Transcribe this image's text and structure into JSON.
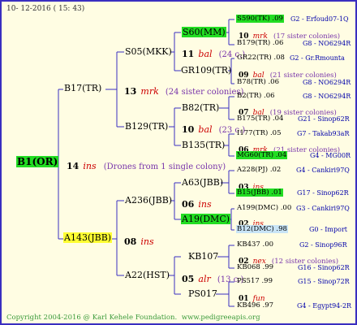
{
  "header": {
    "date": "10- 12-2016 ( 15: 43)"
  },
  "footer": {
    "copyright": "Copyright 2004-2016 @ Karl Kehele Foundation.",
    "site": "www.pedigreeapis.org"
  },
  "colors": {
    "frame_bg": "#fffde3",
    "border": "#3a2ec0",
    "line": "#3a2ec0",
    "highlight_green": "#22dd22",
    "highlight_yellow": "#ffff33",
    "highlight_blue": "#c8e4f6",
    "location": "#0000aa",
    "breeder": "#cc0000",
    "sister": "#7733aa"
  },
  "root": {
    "name": "B1(OR)",
    "gen": "14",
    "breeder": "ins",
    "note": "(Drones from 1 single colony)"
  },
  "father": {
    "name": "B17(TR)",
    "gen": "13",
    "breeder": "mrk",
    "note": "(24 sister colonies)",
    "f": {
      "name": "S05(MKK)",
      "gen": "11",
      "breeder": "bal",
      "note": "(24 c.)",
      "f": {
        "name": "S60(MM)",
        "top": "S590(TK) .09",
        "top_loc": "G2 - Erfoud07-1Q",
        "gen": "10",
        "breeder": "mrk",
        "note": "(17 sister colonies)",
        "bottom": "B179(TR) .06",
        "bottom_loc": "G8 - NO6294R"
      },
      "m": {
        "name": "GR109(TR)",
        "top": "GR22(TR) .08",
        "top_loc": "G2 - Gr.Rmounta",
        "gen": "09",
        "breeder": "bal",
        "note": "(21 sister colonies)",
        "bottom": "B78(TR) .06",
        "bottom_loc": "G8 - NO6294R"
      }
    },
    "m": {
      "name": "B129(TR)",
      "gen": "10",
      "breeder": "bal",
      "note": "(23 c.)",
      "f": {
        "name": "B82(TR)",
        "top": "B2(TR) .06",
        "top_loc": "G8 - NO6294R",
        "gen": "07",
        "breeder": "bal",
        "note": "(19 sister colonies)",
        "bottom": "B175(TR) .04",
        "bottom_loc": "G21 - Sinop62R"
      },
      "m": {
        "name": "B135(TR)",
        "top": "I177(TR) .05",
        "top_loc": "G7 - Takab93aR",
        "gen": "06",
        "breeder": "mrk",
        "note": "(21 sister colonies)",
        "bottom": "MG60(TR) .04",
        "bottom_loc": "G4 - MG00R"
      }
    }
  },
  "mother": {
    "name": "A143(JBB)",
    "gen": "08",
    "breeder": "ins",
    "f": {
      "name": "A236(JBB)",
      "gen": "06",
      "breeder": "ins",
      "f": {
        "name": "A63(JBB)",
        "top": "A228(PJ) .02",
        "top_loc": "G4 - Cankiri97Q",
        "gen": "03",
        "breeder": "ins",
        "bottom": "B15(JBB) .01",
        "bottom_loc": "G17 - Sinop62R"
      },
      "m": {
        "name": "A19(DMC)",
        "top": "A199(DMC) .00",
        "top_loc": "G3 - Cankiri97Q",
        "gen": "02",
        "breeder": "ins",
        "bottom": "B12(DMC) .98",
        "bottom_loc": "G0 - Import"
      }
    },
    "m": {
      "name": "A22(HST)",
      "gen": "05",
      "breeder": "alr",
      "note": "(13 c.)",
      "f": {
        "name": "KB107",
        "top": "KB437 .00",
        "top_loc": "G2 - Sinop96R",
        "gen": "02",
        "breeder": "nex",
        "note": "(12 sister colonies)",
        "bottom": "KB068 .99",
        "bottom_loc": "G16 - Sinop62R"
      },
      "m": {
        "name": "PS017",
        "top": "PS517 .99",
        "top_loc": "G15 - Sinop72R",
        "gen": "01",
        "breeder": "fun",
        "bottom": "KB496 .97",
        "bottom_loc": "G4 - Egypt94-2R"
      }
    }
  }
}
